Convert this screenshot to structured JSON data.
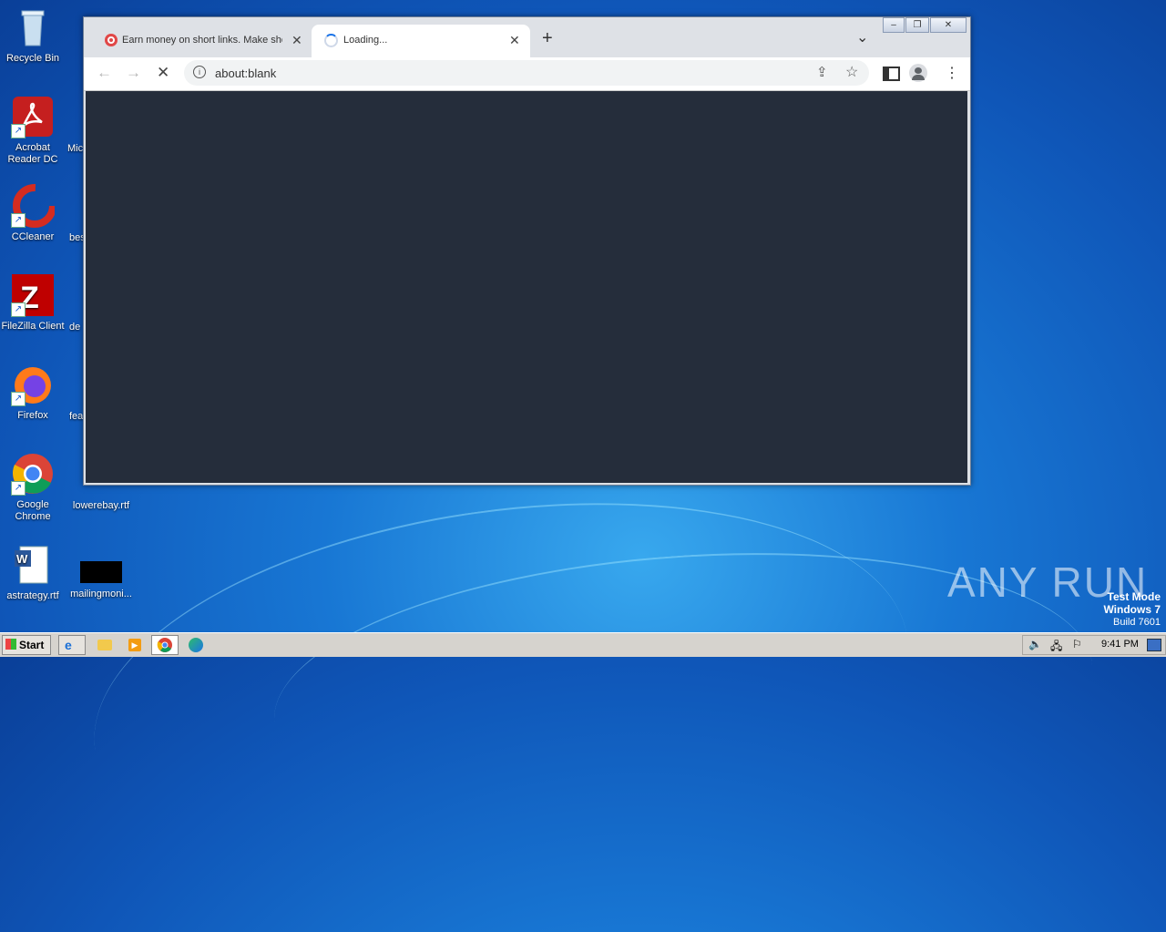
{
  "desktop": {
    "icons": [
      {
        "label": "Recycle Bin",
        "icon": "recycle-bin-icon"
      },
      {
        "label": "Acrobat Reader DC",
        "icon": "acrobat-icon"
      },
      {
        "label": "CCleaner",
        "icon": "ccleaner-icon"
      },
      {
        "label": "FileZilla Client",
        "icon": "filezilla-icon"
      },
      {
        "label": "Firefox",
        "icon": "firefox-icon"
      },
      {
        "label": "Google Chrome",
        "icon": "chrome-icon"
      },
      {
        "label": "astrategy.rtf",
        "icon": "word-doc-icon"
      }
    ],
    "partial_icons": [
      "Mic",
      "bes",
      "de",
      "fea",
      "lowerebay.rtf",
      "mailingmoni..."
    ],
    "watermark": "ANY RUN",
    "os_notice": {
      "line1": "Test Mode",
      "line2": "Windows 7",
      "line3": "Build 7601"
    }
  },
  "browser": {
    "tabs": [
      {
        "title": "Earn money on short links. Make sho",
        "close": "✕",
        "active": false
      },
      {
        "title": "Loading...",
        "close": "✕",
        "active": true
      }
    ],
    "new_tab": "+",
    "tab_search": "⌄",
    "address": "about:blank",
    "window_controls": {
      "minimize": "–",
      "restore": "❐",
      "close": "✕"
    }
  },
  "taskbar": {
    "start_label": "Start",
    "clock": "9:41 PM"
  }
}
